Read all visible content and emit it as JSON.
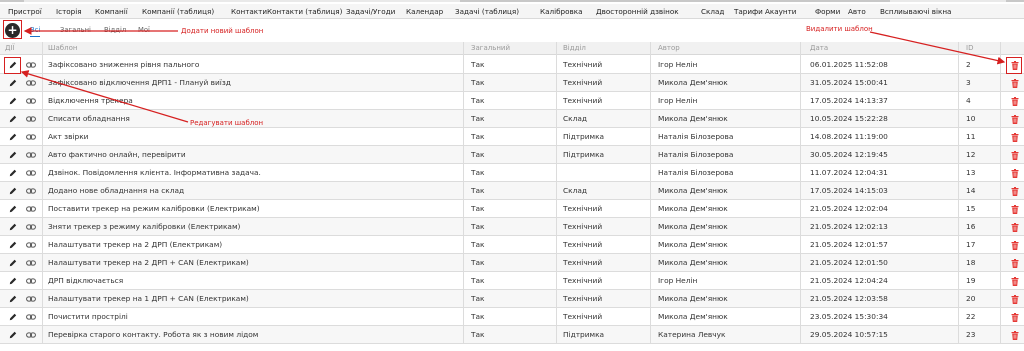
{
  "menu": [
    "Пристрої",
    "Історія",
    "Компанії",
    "Компанії (таблиця)",
    "Контакти",
    "Контакти (таблиця)",
    "Задачі/Угоди",
    "Календар",
    "Задачі (таблиця)",
    "Калібровка",
    "Двосторонній дзвінок",
    "Склад",
    "Тарифи",
    "Акаунти",
    "Форми",
    "Авто",
    "Всплиываючі вікна"
  ],
  "toolbar": {
    "add_icon": "plus-circle-icon",
    "tabs": [
      {
        "label": "Всі",
        "active": true
      },
      {
        "label": "Загальні",
        "active": false
      },
      {
        "label": "Відділ",
        "active": false
      },
      {
        "label": "Мої",
        "active": false
      }
    ]
  },
  "table": {
    "columns": [
      "ДІЇ",
      "Шаблон",
      "Загальний",
      "Відділ",
      "Автор",
      "Дата",
      "ID"
    ],
    "rows": [
      {
        "template": "Зафіксовано зниження рівня пального",
        "general": "Так",
        "dept": "Технічний",
        "author": "Ігор Нелін",
        "date": "06.01.2025 11:52:08",
        "id": "2"
      },
      {
        "template": "Зафіксовано відключення ДРП1 - Плануй виїзд",
        "general": "Так",
        "dept": "Технічний",
        "author": "Микола Дем'янюк",
        "date": "31.05.2024 15:00:41",
        "id": "3"
      },
      {
        "template": "Відключення трекера",
        "general": "Так",
        "dept": "Технічний",
        "author": "Ігор Нелін",
        "date": "17.05.2024 14:13:37",
        "id": "4"
      },
      {
        "template": "Списати обладнання",
        "general": "Так",
        "dept": "Склад",
        "author": "Микола Дем'янюк",
        "date": "10.05.2024 15:22:28",
        "id": "10"
      },
      {
        "template": "Акт звірки",
        "general": "Так",
        "dept": "Підтримка",
        "author": "Наталія Білозерова",
        "date": "14.08.2024 11:19:00",
        "id": "11"
      },
      {
        "template": "Авто фактично онлайн, перевірити",
        "general": "Так",
        "dept": "Підтримка",
        "author": "Наталія Білозерова",
        "date": "30.05.2024 12:19:45",
        "id": "12"
      },
      {
        "template": "Дзвінок. Повідомлення клієнта. Інформативна задача.",
        "general": "Так",
        "dept": "",
        "author": "Наталія Білозерова",
        "date": "11.07.2024 12:04:31",
        "id": "13"
      },
      {
        "template": "Додано нове обладнання на склад",
        "general": "Так",
        "dept": "Склад",
        "author": "Микола Дем'янюк",
        "date": "17.05.2024 14:15:03",
        "id": "14"
      },
      {
        "template": "Поставити трекер на режим калібровки (Електрикам)",
        "general": "Так",
        "dept": "Технічний",
        "author": "Микола Дем'янюк",
        "date": "21.05.2024 12:02:04",
        "id": "15"
      },
      {
        "template": "Зняти трекер з режиму калібровки (Електрикам)",
        "general": "Так",
        "dept": "Технічний",
        "author": "Микола Дем'янюк",
        "date": "21.05.2024 12:02:13",
        "id": "16"
      },
      {
        "template": "Налаштувати трекер на 2 ДРП (Електрикам)",
        "general": "Так",
        "dept": "Технічний",
        "author": "Микола Дем'янюк",
        "date": "21.05.2024 12:01:57",
        "id": "17"
      },
      {
        "template": "Налаштувати трекер на 2 ДРП + CAN (Електрикам)",
        "general": "Так",
        "dept": "Технічний",
        "author": "Микола Дем'янюк",
        "date": "21.05.2024 12:01:50",
        "id": "18"
      },
      {
        "template": "ДРП відключається",
        "general": "Так",
        "dept": "Технічний",
        "author": "Ігор Нелін",
        "date": "21.05.2024 12:04:24",
        "id": "19"
      },
      {
        "template": "Налаштувати трекер на 1 ДРП + CAN (Електрикам)",
        "general": "Так",
        "dept": "Технічний",
        "author": "Микола Дем'янюк",
        "date": "21.05.2024 12:03:58",
        "id": "20"
      },
      {
        "template": "Почистити прострілі",
        "general": "Так",
        "dept": "Технічний",
        "author": "Микола Дем'янюк",
        "date": "23.05.2024 15:30:34",
        "id": "22"
      },
      {
        "template": "Перевірка старого контакту. Робота як з новим лідом",
        "general": "Так",
        "dept": "Підтримка",
        "author": "Катерина Левчук",
        "date": "29.05.2024 10:57:15",
        "id": "23"
      }
    ]
  },
  "annotations": {
    "add_template": "Додати новий шаблон",
    "edit_template": "Редагувати шаблон",
    "delete_template": "Видалити шаблон"
  },
  "colors": {
    "annotation": "#d62020",
    "accent": "#1a73c9",
    "delete": "#e53935"
  },
  "icons": {
    "edit": "pencil-icon",
    "link": "link-icon",
    "delete": "trash-icon"
  }
}
